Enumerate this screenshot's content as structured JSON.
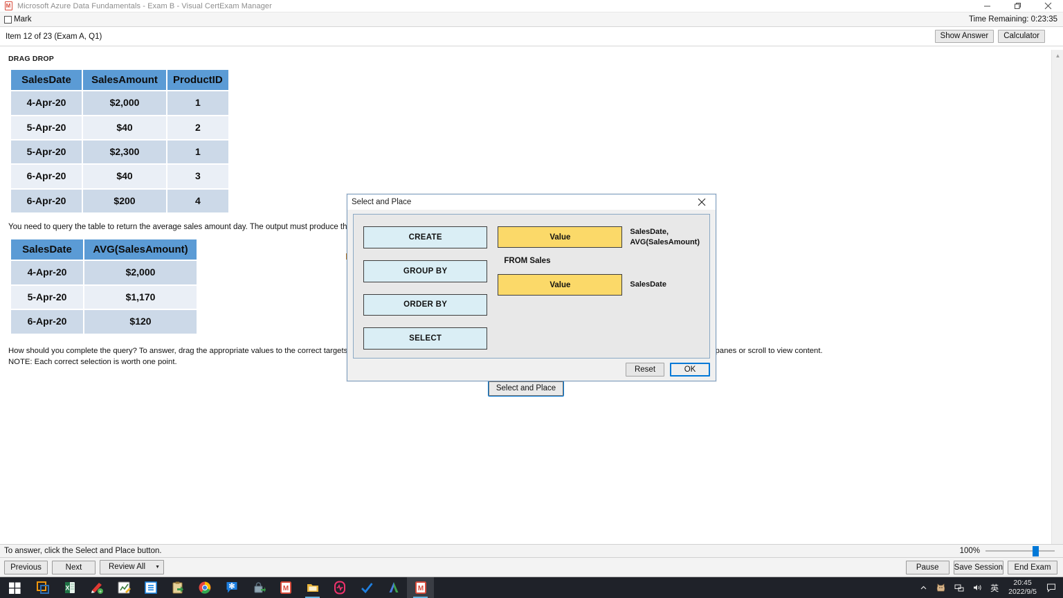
{
  "window": {
    "title": "Microsoft Azure Data Fundamentals - Exam B - Visual CertExam Manager",
    "icon": "certexam-icon",
    "minimize_label": "minimize-icon",
    "maximize_label": "restore-icon",
    "close_label": "close-icon"
  },
  "markbar": {
    "mark_label": "Mark",
    "time_remaining": "Time Remaining: 0:23:35"
  },
  "itembar": {
    "item_label": "Item 12 of 23  (Exam A, Q1)",
    "show_answer_label": "Show Answer",
    "calculator_label": "Calculator"
  },
  "question": {
    "type_label": "DRAG DROP",
    "prompt": "You need to query the table to return the average sales amount day. The output must produce the following",
    "instructions_line1": "How should you complete the query? To answer, drag the appropriate values to the correct targets. Each value may be used once, more than once, or not at all. You may need to drag the split bar between panes or scroll to view content.",
    "instructions_line2": "NOTE: Each correct selection is worth one point.",
    "select_and_place_button": "Select and Place"
  },
  "sales_table": {
    "headers": [
      "SalesDate",
      "SalesAmount",
      "ProductID"
    ],
    "rows": [
      [
        "4-Apr-20",
        "$2,000",
        "1"
      ],
      [
        "5-Apr-20",
        "$40",
        "2"
      ],
      [
        "5-Apr-20",
        "$2,300",
        "1"
      ],
      [
        "6-Apr-20",
        "$40",
        "3"
      ],
      [
        "6-Apr-20",
        "$200",
        "4"
      ]
    ]
  },
  "output_table": {
    "headers": [
      "SalesDate",
      "AVG(SalesAmount)"
    ],
    "rows": [
      [
        "4-Apr-20",
        "$2,000"
      ],
      [
        "5-Apr-20",
        "$1,170"
      ],
      [
        "6-Apr-20",
        "$120"
      ]
    ]
  },
  "dialog": {
    "title": "Select and Place",
    "close_icon": "close-icon",
    "tokens": [
      "CREATE",
      "GROUP BY",
      "ORDER BY",
      "SELECT"
    ],
    "answer_rows": [
      {
        "slot": "Value",
        "caption": "SalesDate,\nAVG(SalesAmount)"
      },
      {
        "static": "FROM Sales"
      },
      {
        "slot": "Value",
        "caption": "SalesDate"
      }
    ],
    "slot1_label": "Value",
    "slot1_caption_line1": "SalesDate,",
    "slot1_caption_line2": "AVG(SalesAmount)",
    "static_clause": "FROM Sales",
    "slot2_label": "Value",
    "slot2_caption": "SalesDate",
    "reset_label": "Reset",
    "ok_label": "OK"
  },
  "statusbar": {
    "text": "To answer, click the Select and Place button.",
    "zoom_percent": "100%"
  },
  "navbar": {
    "previous_label": "Previous",
    "next_label": "Next",
    "review_all_label": "Review All",
    "pause_label": "Pause",
    "save_session_label": "Save Session",
    "end_exam_label": "End Exam"
  },
  "taskbar": {
    "start_icon": "windows-start-icon",
    "items": [
      {
        "icon": "vmware-icon",
        "color": "#f0960c"
      },
      {
        "icon": "excel-icon",
        "color": "#217346"
      },
      {
        "icon": "pdf-editor-icon",
        "color": "#e03a33"
      },
      {
        "icon": "notepad-edit-icon",
        "color": "#7db04a"
      },
      {
        "icon": "evernote-icon",
        "color": "#1e88e5"
      },
      {
        "icon": "clipboard-export-icon",
        "color": "#d8a23a"
      },
      {
        "icon": "chrome-icon",
        "color": "#4285f4"
      },
      {
        "icon": "asterisk-messenger-icon",
        "color": "#1d7fe0"
      },
      {
        "icon": "lock-secure-icon",
        "color": "#6f8a99"
      },
      {
        "icon": "certexam-manager-icon",
        "color": "#d84a3a"
      },
      {
        "icon": "file-explorer-icon",
        "color": "#e8b339"
      },
      {
        "icon": "heartbeat-app-icon",
        "color": "#f0336c"
      },
      {
        "icon": "checkmark-todo-icon",
        "color": "#1f7fe0"
      },
      {
        "icon": "google-ads-icon",
        "color": "#3fa14d"
      },
      {
        "icon": "certexam-manager-active-icon",
        "color": "#d84a3a"
      }
    ],
    "tray": {
      "chevron": "show-hidden-icons-chevron",
      "cat_icon": "tray-cat-icon",
      "network_icon": "network-icon",
      "volume_icon": "volume-icon",
      "ime_label": "英",
      "time": "20:45",
      "date": "2022/9/5",
      "action_center_icon": "action-center-icon"
    }
  }
}
